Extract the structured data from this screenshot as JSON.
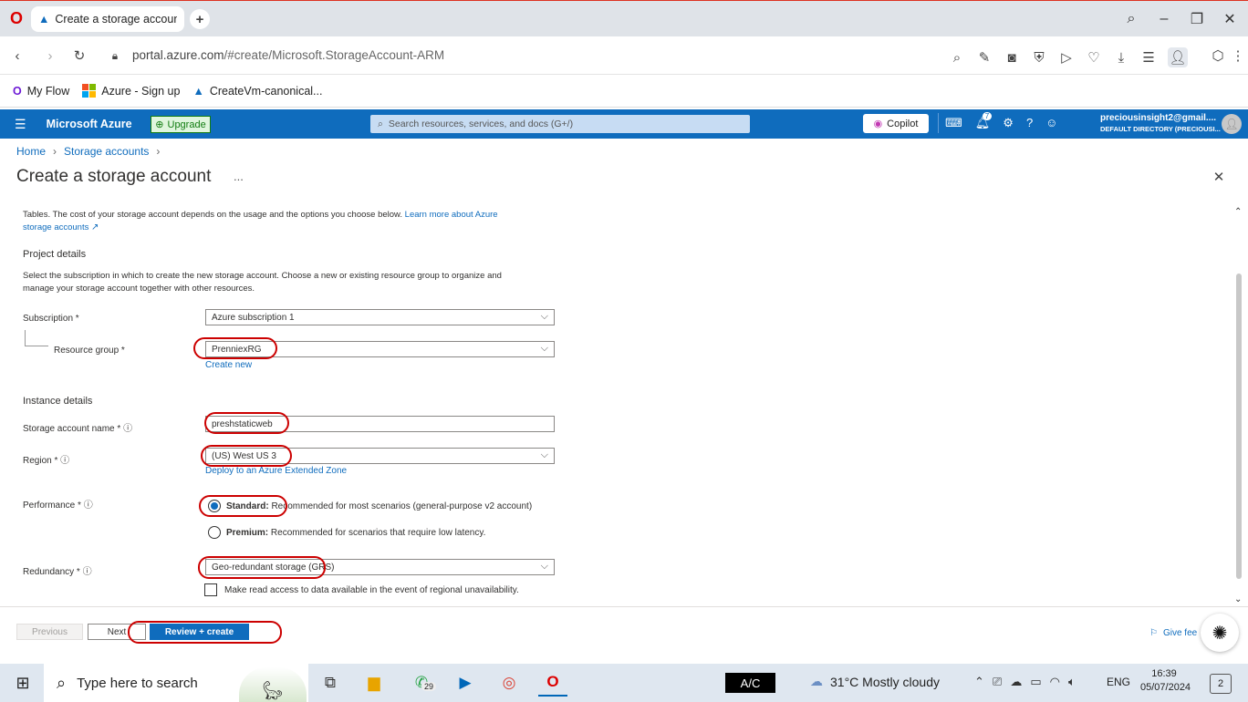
{
  "browser": {
    "tab_title": "Create a storage account",
    "new_tab": "+",
    "url_host": "portal.azure.com",
    "url_path": "/#create/Microsoft.StorageAccount-ARM",
    "bookmarks": [
      "My Flow",
      "Azure - Sign up",
      "CreateVm-canonical..."
    ]
  },
  "azure": {
    "brand": "Microsoft Azure",
    "upgrade": "Upgrade",
    "search_placeholder": "Search resources, services, and docs (G+/)",
    "copilot": "Copilot",
    "notif_count": "7",
    "user_email": "preciousinsight2@gmail....",
    "user_dir": "DEFAULT DIRECTORY (PRECIOUSI..."
  },
  "breadcrumb": {
    "home": "Home",
    "storage": "Storage accounts"
  },
  "page_title": "Create a storage account",
  "more": "...",
  "intro_text": "Tables. The cost of your storage account depends on the usage and the options you choose below.",
  "intro_link1": "Learn more about Azure",
  "intro_link2": "storage accounts",
  "project": {
    "heading": "Project details",
    "desc1": "Select the subscription in which to create the new storage account. Choose a new or existing resource group to organize and",
    "desc2": "manage your storage account together with other resources.",
    "subscription_label": "Subscription *",
    "subscription_value": "Azure subscription 1",
    "rg_label": "Resource group *",
    "rg_value": "PrenniexRG",
    "create_new": "Create new"
  },
  "instance": {
    "heading": "Instance details",
    "name_label": "Storage account name *",
    "name_value": "preshstaticweb",
    "region_label": "Region *",
    "region_value": "(US) West US 3",
    "extended_zone": "Deploy to an Azure Extended Zone",
    "perf_label": "Performance *",
    "standard_bold": "Standard:",
    "standard_text": "Recommended for most scenarios (general-purpose v2 account)",
    "premium_bold": "Premium:",
    "premium_text": "Recommended for scenarios that require low latency.",
    "redundancy_label": "Redundancy *",
    "redundancy_value": "Geo-redundant storage (GRS)",
    "read_access": "Make read access to data available in the event of regional unavailability."
  },
  "footer": {
    "previous": "Previous",
    "next": "Next",
    "review": "Review + create",
    "feedback": "Give fee"
  },
  "taskbar": {
    "search": "Type here to search",
    "whatsapp_badge": "29",
    "ac": "A/C",
    "weather": "31°C  Mostly cloudy",
    "lang": "ENG",
    "time": "16:39",
    "date": "05/07/2024",
    "notif": "2"
  },
  "colors": {
    "azure_blue": "#0f6cbd",
    "highlight_red": "#c00000"
  }
}
